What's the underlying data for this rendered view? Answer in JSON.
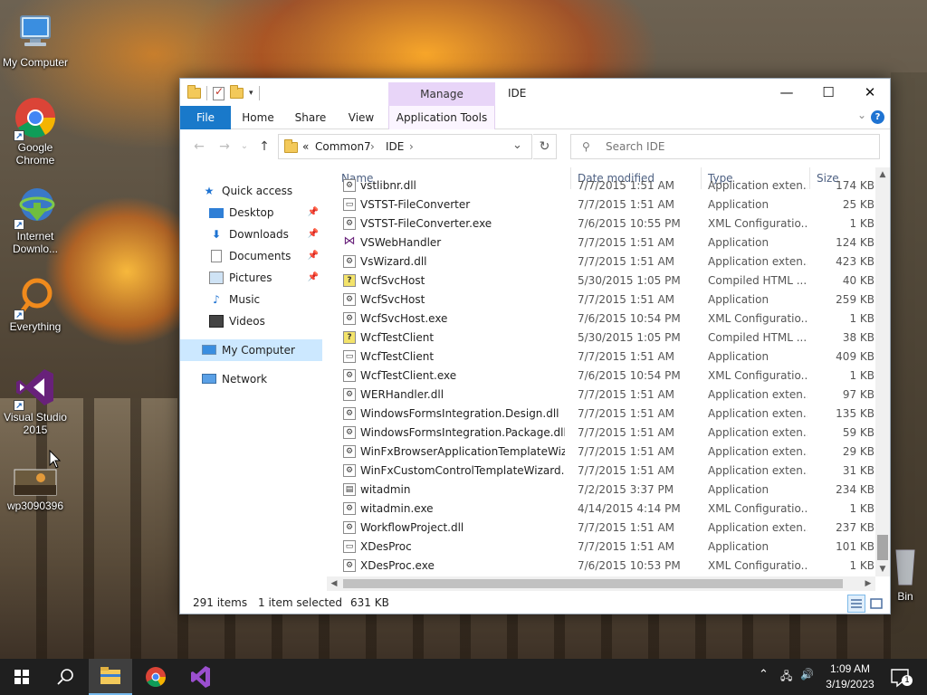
{
  "desktop": {
    "icons": [
      {
        "label": "My Computer",
        "icon": "monitor-icon"
      },
      {
        "label": "Google Chrome",
        "icon": "chrome-icon"
      },
      {
        "label": "Internet Downlo...",
        "icon": "idm-icon"
      },
      {
        "label": "Everything",
        "icon": "everything-icon"
      },
      {
        "label": "Visual Studio 2015",
        "icon": "visual-studio-icon"
      },
      {
        "label": "wp3090396",
        "icon": "image-file-icon"
      },
      {
        "label": "Bin",
        "icon": "recycle-bin-icon"
      }
    ]
  },
  "window": {
    "title": "IDE",
    "manage_tab": "Manage",
    "ribbon_tabs": [
      "File",
      "Home",
      "Share",
      "View",
      "Application Tools"
    ],
    "controls": {
      "minimize": "—",
      "maximize": "☐",
      "close": "✕"
    },
    "help": "?"
  },
  "address": {
    "prefix": "«",
    "crumbs": [
      "Common7",
      "IDE"
    ],
    "separator": "›"
  },
  "search": {
    "placeholder": "Search IDE"
  },
  "nav_pane": {
    "quick_access": "Quick access",
    "items": [
      {
        "label": "Desktop",
        "pinned": true
      },
      {
        "label": "Downloads",
        "pinned": true
      },
      {
        "label": "Documents",
        "pinned": true
      },
      {
        "label": "Pictures",
        "pinned": true
      },
      {
        "label": "Music",
        "pinned": false
      },
      {
        "label": "Videos",
        "pinned": false
      }
    ],
    "this_pc": "My Computer",
    "network": "Network"
  },
  "columns": {
    "name": "Name",
    "date": "Date modified",
    "type": "Type",
    "size": "Size"
  },
  "files": [
    {
      "name": "vstlibnr.dll",
      "date": "7/7/2015 1:51 AM",
      "type": "Application exten...",
      "size": "174 KB",
      "kind": "dll"
    },
    {
      "name": "VSTST-FileConverter",
      "date": "7/7/2015 1:51 AM",
      "type": "Application",
      "size": "25 KB",
      "kind": "app"
    },
    {
      "name": "VSTST-FileConverter.exe",
      "date": "7/6/2015 10:55 PM",
      "type": "XML Configuratio...",
      "size": "1 KB",
      "kind": "config"
    },
    {
      "name": "VSWebHandler",
      "date": "7/7/2015 1:51 AM",
      "type": "Application",
      "size": "124 KB",
      "kind": "vs"
    },
    {
      "name": "VsWizard.dll",
      "date": "7/7/2015 1:51 AM",
      "type": "Application exten...",
      "size": "423 KB",
      "kind": "dll"
    },
    {
      "name": "WcfSvcHost",
      "date": "5/30/2015 1:05 PM",
      "type": "Compiled HTML ...",
      "size": "40 KB",
      "kind": "help"
    },
    {
      "name": "WcfSvcHost",
      "date": "7/7/2015 1:51 AM",
      "type": "Application",
      "size": "259 KB",
      "kind": "gear"
    },
    {
      "name": "WcfSvcHost.exe",
      "date": "7/6/2015 10:54 PM",
      "type": "XML Configuratio...",
      "size": "1 KB",
      "kind": "config"
    },
    {
      "name": "WcfTestClient",
      "date": "5/30/2015 1:05 PM",
      "type": "Compiled HTML ...",
      "size": "38 KB",
      "kind": "help"
    },
    {
      "name": "WcfTestClient",
      "date": "7/7/2015 1:51 AM",
      "type": "Application",
      "size": "409 KB",
      "kind": "app"
    },
    {
      "name": "WcfTestClient.exe",
      "date": "7/6/2015 10:54 PM",
      "type": "XML Configuratio...",
      "size": "1 KB",
      "kind": "config"
    },
    {
      "name": "WERHandler.dll",
      "date": "7/7/2015 1:51 AM",
      "type": "Application exten...",
      "size": "97 KB",
      "kind": "dll"
    },
    {
      "name": "WindowsFormsIntegration.Design.dll",
      "date": "7/7/2015 1:51 AM",
      "type": "Application exten...",
      "size": "135 KB",
      "kind": "dll"
    },
    {
      "name": "WindowsFormsIntegration.Package.dll",
      "date": "7/7/2015 1:51 AM",
      "type": "Application exten...",
      "size": "59 KB",
      "kind": "dll"
    },
    {
      "name": "WinFxBrowserApplicationTemplateWizar...",
      "date": "7/7/2015 1:51 AM",
      "type": "Application exten...",
      "size": "29 KB",
      "kind": "dll"
    },
    {
      "name": "WinFxCustomControlTemplateWizard.dll",
      "date": "7/7/2015 1:51 AM",
      "type": "Application exten...",
      "size": "31 KB",
      "kind": "dll"
    },
    {
      "name": "witadmin",
      "date": "7/2/2015 3:37 PM",
      "type": "Application",
      "size": "234 KB",
      "kind": "cmd"
    },
    {
      "name": "witadmin.exe",
      "date": "4/14/2015 4:14 PM",
      "type": "XML Configuratio...",
      "size": "1 KB",
      "kind": "config"
    },
    {
      "name": "WorkflowProject.dll",
      "date": "7/7/2015 1:51 AM",
      "type": "Application exten...",
      "size": "237 KB",
      "kind": "dll"
    },
    {
      "name": "XDesProc",
      "date": "7/7/2015 1:51 AM",
      "type": "Application",
      "size": "101 KB",
      "kind": "app"
    },
    {
      "name": "XDesProc.exe",
      "date": "7/6/2015 10:53 PM",
      "type": "XML Configuratio...",
      "size": "1 KB",
      "kind": "config"
    }
  ],
  "status": {
    "count": "291 items",
    "selected": "1 item selected",
    "size": "631 KB"
  },
  "taskbar": {
    "time": "1:09 AM",
    "date": "3/19/2023",
    "notifications": "1"
  },
  "colors": {
    "accent": "#1979ca",
    "selection": "#cce8ff",
    "manage": "#e8d5f8",
    "taskbar": "#1f1f1f"
  }
}
